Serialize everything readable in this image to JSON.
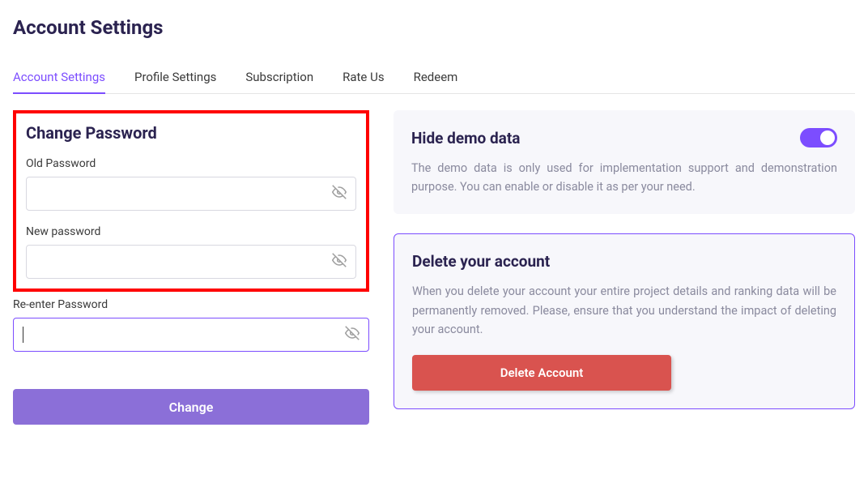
{
  "page_title": "Account Settings",
  "tabs": [
    {
      "label": "Account Settings",
      "active": true
    },
    {
      "label": "Profile Settings",
      "active": false
    },
    {
      "label": "Subscription",
      "active": false
    },
    {
      "label": "Rate Us",
      "active": false
    },
    {
      "label": "Redeem",
      "active": false
    }
  ],
  "change_password": {
    "heading": "Change Password",
    "old_label": "Old Password",
    "old_value": "",
    "new_label": "New password",
    "new_value": "",
    "reenter_label": "Re-enter Password",
    "reenter_value": "",
    "button": "Change"
  },
  "hide_demo": {
    "title": "Hide demo data",
    "text": "The demo data is only used for implementation support and demonstration purpose. You can enable or disable it as per your need.",
    "enabled": true
  },
  "delete_account": {
    "title": "Delete your account",
    "text": "When you delete your account your entire project details and ranking data will be permanently removed. Please, ensure that you understand the impact of deleting your account.",
    "button": "Delete Account"
  },
  "colors": {
    "accent": "#7c4dff",
    "primary_btn": "#8b6fd8",
    "danger": "#d9534f",
    "highlight": "#ff0000"
  }
}
